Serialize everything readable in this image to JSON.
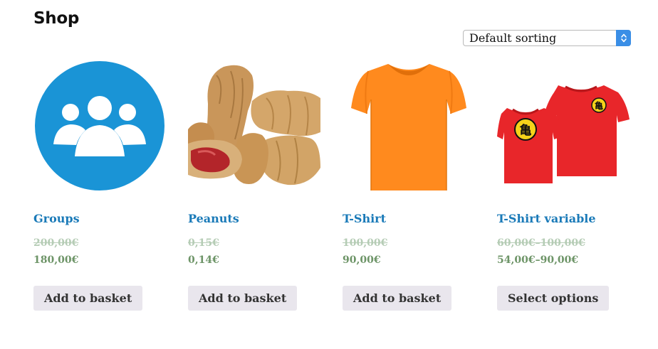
{
  "page": {
    "title": "Shop"
  },
  "sorting": {
    "selected": "Default sorting",
    "icon": "updown-arrows-icon"
  },
  "colors": {
    "link": "#1a7ab8",
    "price": "#6d9467",
    "button_bg": "#e9e6ed",
    "accent": "#3a8ee6"
  },
  "products": [
    {
      "name": "Groups",
      "old_price": "200,00€",
      "price": "180,00€",
      "button": "Add to basket",
      "image": "groups-people-icon"
    },
    {
      "name": "Peanuts",
      "old_price": "0,15€",
      "price": "0,14€",
      "button": "Add to basket",
      "image": "peanuts-photo"
    },
    {
      "name": "T-Shirt",
      "old_price": "100,00€",
      "price": "90,00€",
      "button": "Add to basket",
      "image": "orange-tshirt"
    },
    {
      "name": "T-Shirt variable",
      "old_price": "60,00€–100,00€",
      "price": "54,00€–90,00€",
      "button": "Select options",
      "image": "red-tshirts"
    }
  ]
}
